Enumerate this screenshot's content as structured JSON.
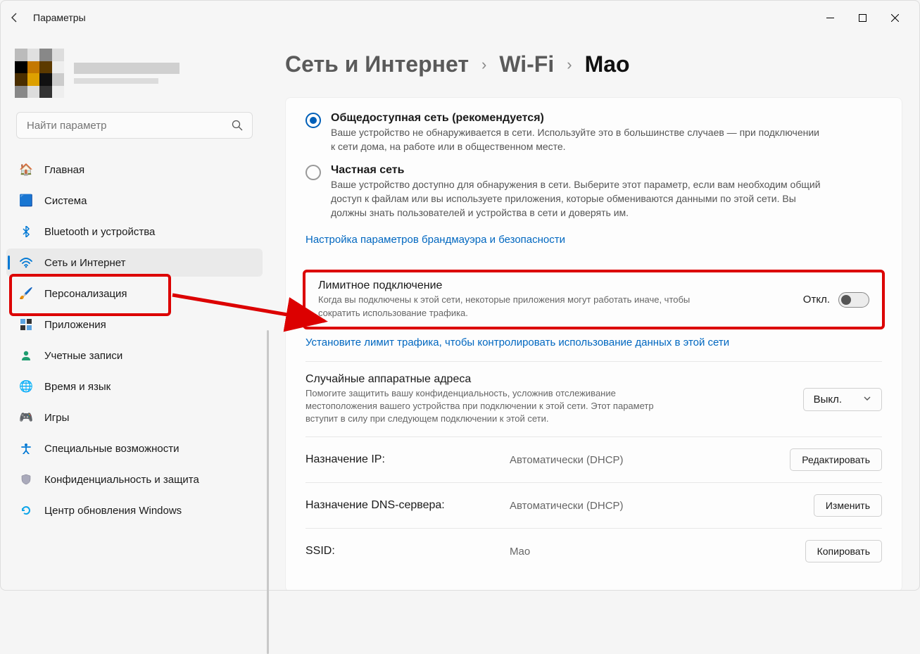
{
  "app": {
    "title": "Параметры"
  },
  "search": {
    "placeholder": "Найти параметр"
  },
  "sidebar": {
    "items": [
      {
        "label": "Главная"
      },
      {
        "label": "Система"
      },
      {
        "label": "Bluetooth и устройства"
      },
      {
        "label": "Сеть и Интернет"
      },
      {
        "label": "Персонализация"
      },
      {
        "label": "Приложения"
      },
      {
        "label": "Учетные записи"
      },
      {
        "label": "Время и язык"
      },
      {
        "label": "Игры"
      },
      {
        "label": "Специальные возможности"
      },
      {
        "label": "Конфиденциальность и защита"
      },
      {
        "label": "Центр обновления Windows"
      }
    ]
  },
  "breadcrumb": {
    "level1": "Сеть и Интернет",
    "level2": "Wi-Fi",
    "current": "Mao"
  },
  "network_profile": {
    "public": {
      "title": "Общедоступная сеть (рекомендуется)",
      "desc": "Ваше устройство не обнаруживается в сети. Используйте это в большинстве случаев — при подключении к сети дома, на работе или в общественном месте."
    },
    "private": {
      "title": "Частная сеть",
      "desc": "Ваше устройство доступно для обнаружения в сети. Выберите этот параметр, если вам необходим общий доступ к файлам или вы используете приложения, которые обмениваются данными по этой сети. Вы должны знать пользователей и устройства в сети и доверять им."
    },
    "firewall_link": "Настройка параметров брандмауэра и безопасности"
  },
  "metered": {
    "title": "Лимитное подключение",
    "desc": "Когда вы подключены к этой сети, некоторые приложения могут работать иначе, чтобы сократить использование трафика.",
    "state": "Откл.",
    "data_limit_link": "Установите лимит трафика, чтобы контролировать использование данных в этой сети"
  },
  "random_mac": {
    "title": "Случайные аппаратные адреса",
    "desc": "Помогите защитить вашу конфиденциальность, усложнив отслеживание местоположения вашего устройства при подключении к этой сети. Этот параметр вступит в силу при следующем подключении к этой сети.",
    "dropdown_value": "Выкл."
  },
  "ip": {
    "label": "Назначение IP:",
    "value": "Автоматически (DHCP)",
    "button": "Редактировать"
  },
  "dns": {
    "label": "Назначение DNS-сервера:",
    "value": "Автоматически (DHCP)",
    "button": "Изменить"
  },
  "ssid": {
    "label": "SSID:",
    "value": "Mao",
    "button": "Копировать"
  }
}
